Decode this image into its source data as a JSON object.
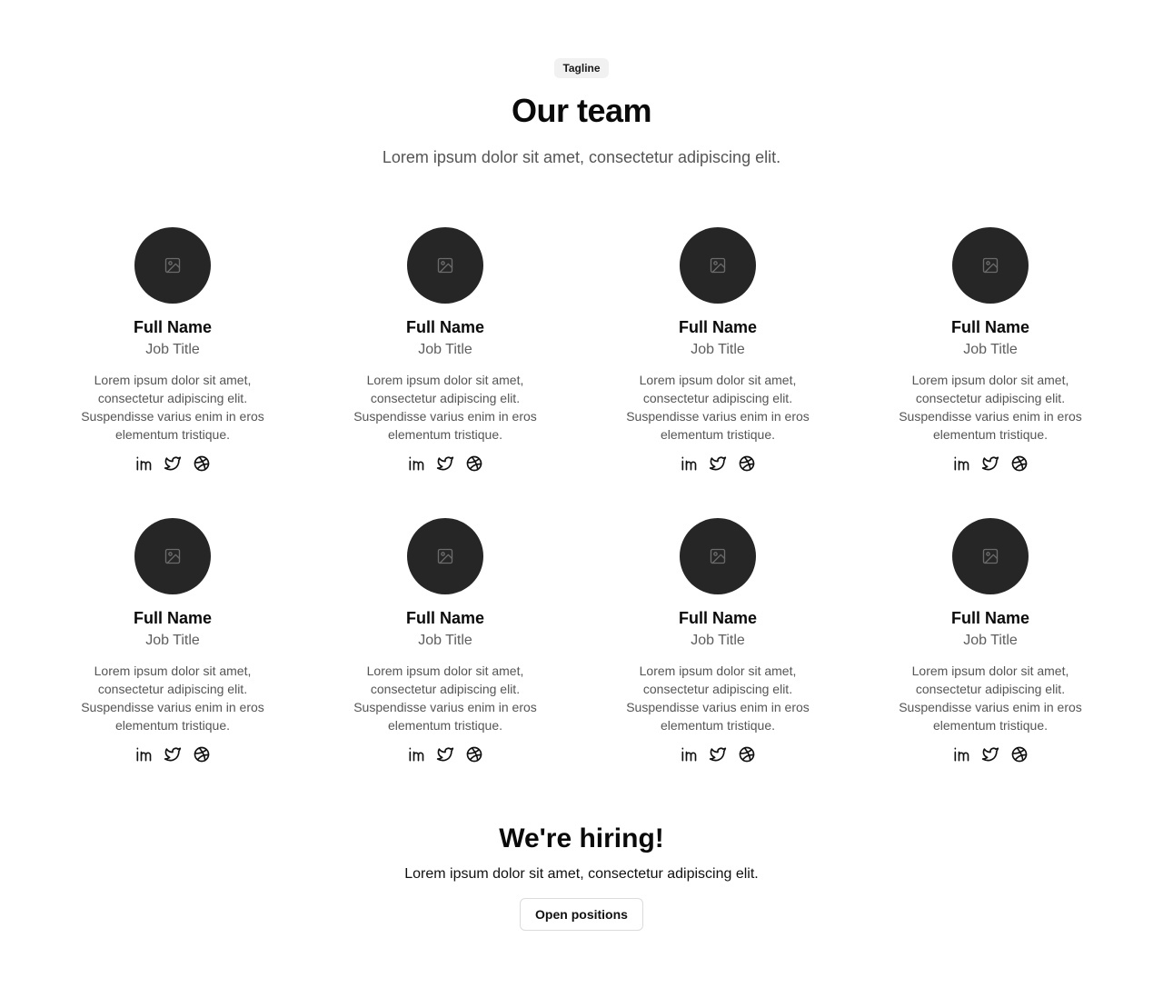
{
  "header": {
    "tagline": "Tagline",
    "title": "Our team",
    "subtitle": "Lorem ipsum dolor sit amet, consectetur adipiscing elit."
  },
  "team": [
    {
      "name": "Full Name",
      "job": "Job Title",
      "bio": "Lorem ipsum dolor sit amet, consectetur adipiscing elit. Suspendisse varius enim in eros elementum tristique."
    },
    {
      "name": "Full Name",
      "job": "Job Title",
      "bio": "Lorem ipsum dolor sit amet, consectetur adipiscing elit. Suspendisse varius enim in eros elementum tristique."
    },
    {
      "name": "Full Name",
      "job": "Job Title",
      "bio": "Lorem ipsum dolor sit amet, consectetur adipiscing elit. Suspendisse varius enim in eros elementum tristique."
    },
    {
      "name": "Full Name",
      "job": "Job Title",
      "bio": "Lorem ipsum dolor sit amet, consectetur adipiscing elit. Suspendisse varius enim in eros elementum tristique."
    },
    {
      "name": "Full Name",
      "job": "Job Title",
      "bio": "Lorem ipsum dolor sit amet, consectetur adipiscing elit. Suspendisse varius enim in eros elementum tristique."
    },
    {
      "name": "Full Name",
      "job": "Job Title",
      "bio": "Lorem ipsum dolor sit amet, consectetur adipiscing elit. Suspendisse varius enim in eros elementum tristique."
    },
    {
      "name": "Full Name",
      "job": "Job Title",
      "bio": "Lorem ipsum dolor sit amet, consectetur adipiscing elit. Suspendisse varius enim in eros elementum tristique."
    },
    {
      "name": "Full Name",
      "job": "Job Title",
      "bio": "Lorem ipsum dolor sit amet, consectetur adipiscing elit. Suspendisse varius enim in eros elementum tristique."
    }
  ],
  "social_icons": [
    "linkedin-icon",
    "twitter-icon",
    "dribbble-icon"
  ],
  "hiring": {
    "title": "We're hiring!",
    "text": "Lorem ipsum dolor sit amet, consectetur adipiscing elit.",
    "button_label": "Open positions"
  },
  "colors": {
    "avatar_bg": "#262626",
    "tagline_bg": "#f1f1f1",
    "muted_text": "#555555"
  }
}
